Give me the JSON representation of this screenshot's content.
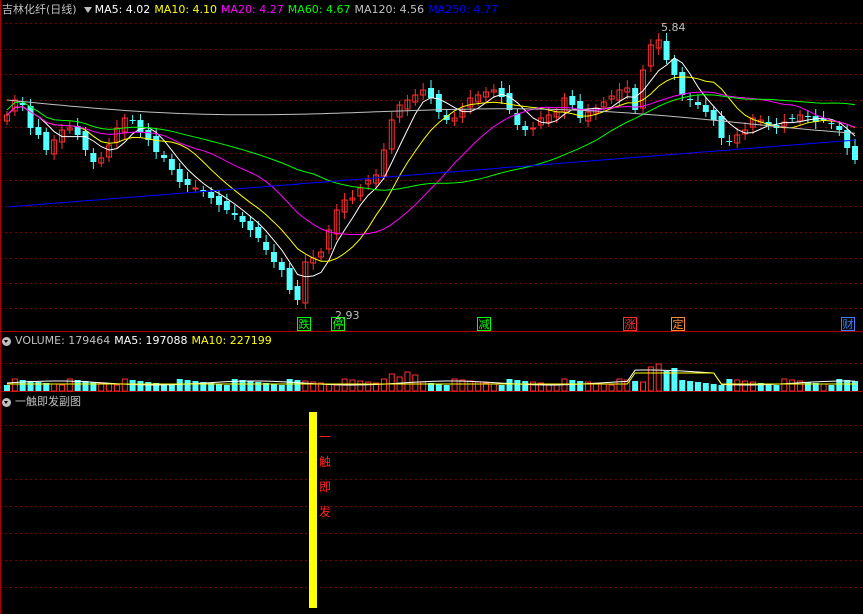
{
  "stock": {
    "name": "吉林化纤",
    "period": "(日线)"
  },
  "main_indicators": [
    {
      "label": "MA5: 4.02",
      "color": "#ffffff"
    },
    {
      "label": "MA10: 4.10",
      "color": "#ffff00"
    },
    {
      "label": "MA20: 4.27",
      "color": "#ff00ff"
    },
    {
      "label": "MA60: 4.67",
      "color": "#00ff00"
    },
    {
      "label": "MA120: 4.56",
      "color": "#c0c0c0"
    },
    {
      "label": "MA250: 4.77",
      "color": "#0000ff"
    }
  ],
  "price_markers": {
    "high": "5.84",
    "low": "2.93"
  },
  "event_tags": [
    {
      "text": "跌",
      "color": "#00ff00"
    },
    {
      "text": "停",
      "color": "#00ff00"
    },
    {
      "text": "减",
      "color": "#00ff00"
    },
    {
      "text": "涨",
      "color": "#ff3030"
    },
    {
      "text": "定",
      "color": "#ff8c30"
    },
    {
      "text": "财",
      "color": "#4080ff"
    }
  ],
  "volume_panel": {
    "title": "VOLUME: 179464",
    "ma5": "MA5: 197088",
    "ma10": "MA10: 227199",
    "title_color": "#c0c0c0",
    "ma5_color": "#ffffff",
    "ma10_color": "#ffff00"
  },
  "sub_panel": {
    "title": "一触即发副图",
    "signal_chars": [
      "一",
      "触",
      "即",
      "发"
    ],
    "signal_bar_color": "#ffff00",
    "signal_text_color": "#ff2020"
  },
  "colors": {
    "up": "#ff3030",
    "down": "#54ffff",
    "grid": "#7a0000",
    "border": "#b00000"
  },
  "icons": [
    "collapse-circle-icon",
    "dropdown-arrow-icon"
  ]
}
